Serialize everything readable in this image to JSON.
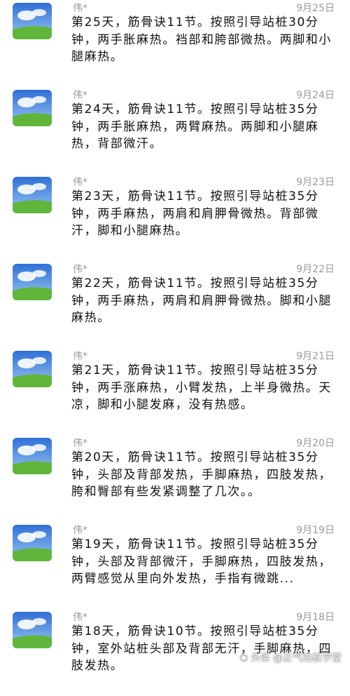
{
  "colors": {
    "meta_gray": "#9a9a9a",
    "text": "#111111",
    "sky_top": "#2f6fd6",
    "sky_bottom": "#9cc8f2",
    "grass": "#5fb63a"
  },
  "feed": {
    "entries": [
      {
        "author": "伟*",
        "date": "9月25日",
        "text": "第25天，筋骨诀11节。按照引导站桩30分钟，两手胀麻热。裆部和胯部微热。两脚和小腿麻热。"
      },
      {
        "author": "伟*",
        "date": "9月24日",
        "text": "第24天，筋骨诀11节。按照引导站桩35分钟，两手胀麻热，两臂麻热。两脚和小腿麻热，背部微汗。"
      },
      {
        "author": "伟*",
        "date": "9月23日",
        "text": "第23天，筋骨诀11节。按照引导站桩35分钟，两手麻热，两肩和肩胛骨微热。背部微汗，脚和小腿麻热。"
      },
      {
        "author": "伟*",
        "date": "9月22日",
        "text": "第22天，筋骨诀11节。按照引导站桩35分钟，两手麻热，两肩和肩胛骨微热。脚和小腿麻热。"
      },
      {
        "author": "伟*",
        "date": "9月21日",
        "text": "第21天，筋骨诀11节。按照引导站桩35分钟，两手涨麻热，小臂发热，上半身微热。天凉，脚和小腿发麻，没有热感。"
      },
      {
        "author": "伟*",
        "date": "9月20日",
        "text": "第20天，筋骨诀11节。按照引导站桩35分钟，头部及背部发热，手脚麻热，四肢发热，胯和臀部有些发紧调整了几次。。"
      },
      {
        "author": "伟*",
        "date": "9月19日",
        "text": "第19天，筋骨诀11节。按照引导站桩35分钟，头部及背部微汗，手脚麻热，四肢发热，两臂感觉从里向外发热，手指有微跳..."
      },
      {
        "author": "伟*",
        "date": "9月18日",
        "text": "第18天，筋骨诀10节。按照引导站桩35分钟，室外站桩头部及背部无汗，手脚麻热，四肢发热。"
      }
    ]
  },
  "watermark": {
    "source": "头条",
    "account": "@正气站桩学堂"
  }
}
